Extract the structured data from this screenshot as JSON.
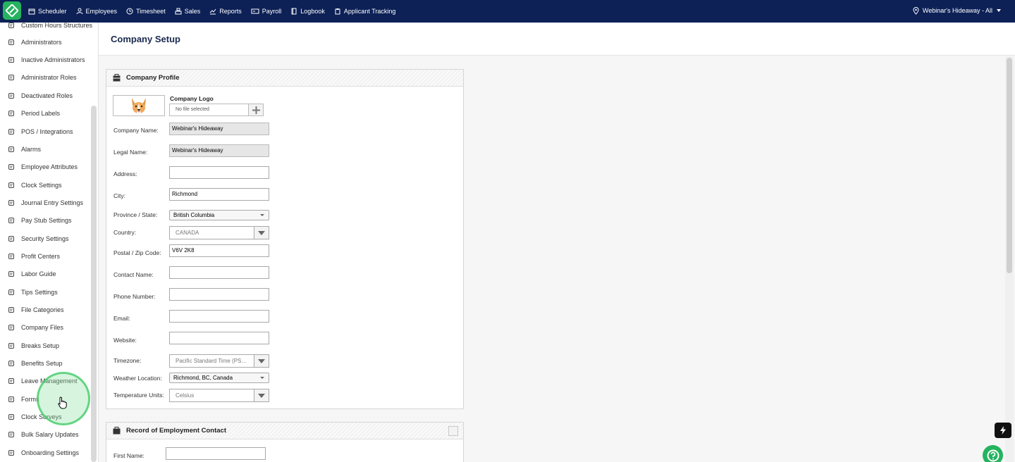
{
  "topbar": {
    "nav": [
      {
        "label": "Scheduler",
        "icon": "calendar-icon"
      },
      {
        "label": "Employees",
        "icon": "person-icon"
      },
      {
        "label": "Timesheet",
        "icon": "clock-icon"
      },
      {
        "label": "Sales",
        "icon": "cash-register-icon"
      },
      {
        "label": "Reports",
        "icon": "trend-icon"
      },
      {
        "label": "Payroll",
        "icon": "payroll-icon"
      },
      {
        "label": "Logbook",
        "icon": "book-icon"
      },
      {
        "label": "Applicant Tracking",
        "icon": "clipboard-icon"
      }
    ],
    "location": "Webinar's Hideaway - All",
    "brand_color": "#25b35f",
    "bar_color": "#0d2157"
  },
  "sidebar": {
    "items": [
      {
        "label": "Custom Hours Structures",
        "icon": "clock-list-icon"
      },
      {
        "label": "Administrators",
        "icon": "admin-icon"
      },
      {
        "label": "Inactive Administrators",
        "icon": "inactive-admin-icon"
      },
      {
        "label": "Administrator Roles",
        "icon": "admin-role-icon"
      },
      {
        "label": "Deactivated Roles",
        "icon": "deactivated-role-icon"
      },
      {
        "label": "Period Labels",
        "icon": "tag-icon"
      },
      {
        "label": "POS / Integrations",
        "icon": "pos-icon"
      },
      {
        "label": "Alarms",
        "icon": "alarm-icon"
      },
      {
        "label": "Employee Attributes",
        "icon": "attributes-icon"
      },
      {
        "label": "Clock Settings",
        "icon": "clock-settings-icon"
      },
      {
        "label": "Journal Entry Settings",
        "icon": "journal-icon"
      },
      {
        "label": "Pay Stub Settings",
        "icon": "paystub-icon"
      },
      {
        "label": "Security Settings",
        "icon": "lock-icon"
      },
      {
        "label": "Profit Centers",
        "icon": "building-icon"
      },
      {
        "label": "Labor Guide",
        "icon": "labor-icon"
      },
      {
        "label": "Tips Settings",
        "icon": "tips-icon"
      },
      {
        "label": "File Categories",
        "icon": "folders-icon"
      },
      {
        "label": "Company Files",
        "icon": "files-icon"
      },
      {
        "label": "Breaks Setup",
        "icon": "coffee-icon"
      },
      {
        "label": "Benefits Setup",
        "icon": "benefits-icon"
      },
      {
        "label": "Leave Management",
        "icon": "leave-icon"
      },
      {
        "label": "Forms",
        "icon": "form-icon"
      },
      {
        "label": "Clock Surveys",
        "icon": "survey-icon"
      },
      {
        "label": "Bulk Salary Updates",
        "icon": "salary-icon"
      },
      {
        "label": "Onboarding Settings",
        "icon": "onboarding-icon"
      }
    ]
  },
  "page": {
    "title": "Company Setup"
  },
  "company_profile": {
    "heading": "Company Profile",
    "logo_label": "Company Logo",
    "file_placeholder": "No file selected",
    "fields": {
      "company_name": {
        "label": "Company Name:",
        "value": "Webinar's Hideaway"
      },
      "legal_name": {
        "label": "Legal Name:",
        "value": "Webinar's Hideaway"
      },
      "address": {
        "label": "Address:",
        "value": ""
      },
      "city": {
        "label": "City:",
        "value": "Richmond"
      },
      "province": {
        "label": "Province / State:",
        "value": "British Columbia"
      },
      "country": {
        "label": "Country:",
        "value": "CANADA"
      },
      "postal": {
        "label": "Postal / Zip Code:",
        "value": "V6V 2K8"
      },
      "contact_name": {
        "label": "Contact Name:",
        "value": ""
      },
      "phone": {
        "label": "Phone Number:",
        "value": ""
      },
      "email": {
        "label": "Email:",
        "value": ""
      },
      "website": {
        "label": "Website:",
        "value": ""
      },
      "timezone": {
        "label": "Timezone:",
        "value": "Pacific Standard Time (PS…"
      },
      "weather": {
        "label": "Weather Location:",
        "value": "Richmond, BC, Canada"
      },
      "temperature": {
        "label": "Temperature Units:",
        "value": "Celsius"
      }
    }
  },
  "roe_contact": {
    "heading": "Record of Employment Contact",
    "first_name": {
      "label": "First Name:",
      "value": ""
    }
  }
}
